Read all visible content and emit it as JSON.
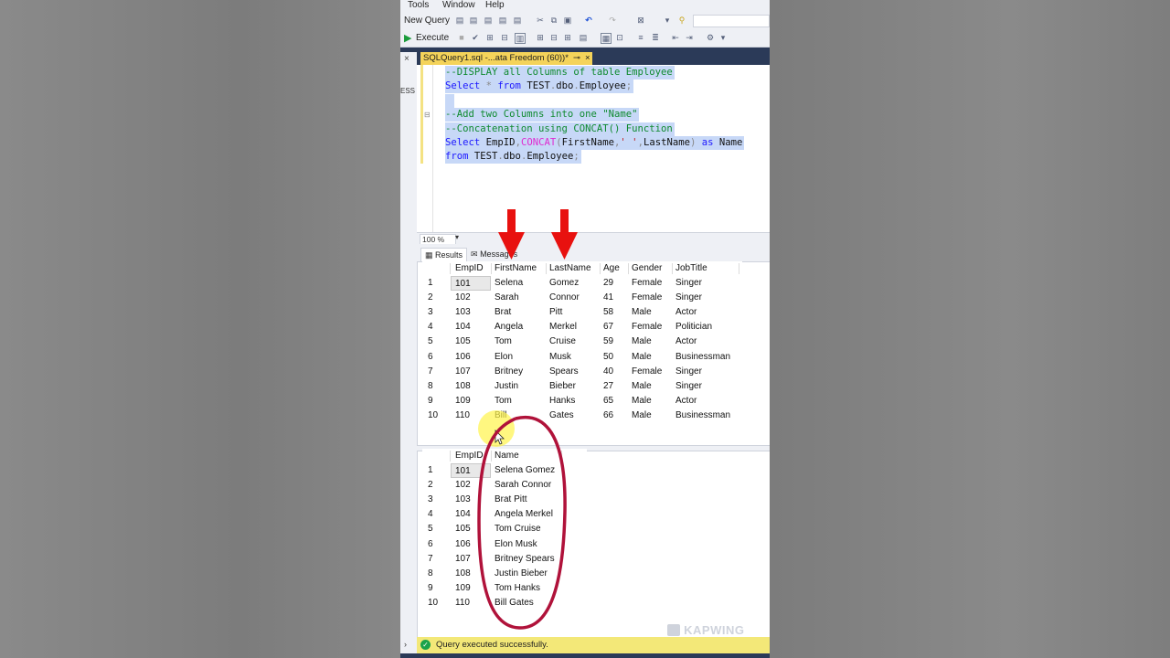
{
  "menu": [
    "Tools",
    "Window",
    "Help"
  ],
  "toolbar": {
    "new_query_label": "New Query",
    "execute_label": "Execute"
  },
  "left_strip_text": "ESS",
  "tab": {
    "title": "SQLQuery1.sql -...ata Freedom (60))*",
    "pin": "⊸",
    "close": "×"
  },
  "code_lines": [
    {
      "segments": [
        {
          "t": "--DISPLAY all Columns of table Employee",
          "c": "cm"
        }
      ]
    },
    {
      "segments": [
        {
          "t": "Select",
          "c": "kw"
        },
        {
          "t": " * ",
          "c": "gr"
        },
        {
          "t": "from",
          "c": "kw"
        },
        {
          "t": " TEST",
          "c": "id"
        },
        {
          "t": ".",
          "c": "gr"
        },
        {
          "t": "dbo",
          "c": "id"
        },
        {
          "t": ".",
          "c": "gr"
        },
        {
          "t": "Employee",
          "c": "id"
        },
        {
          "t": ";",
          "c": "gr"
        }
      ]
    },
    {
      "segments": [
        {
          "t": "",
          "c": "id"
        }
      ]
    },
    {
      "segments": [
        {
          "t": "--Add two Columns into one \"Name\"",
          "c": "cm"
        }
      ]
    },
    {
      "segments": [
        {
          "t": "--Concatenation using CONCAT() Function",
          "c": "cm"
        }
      ]
    },
    {
      "segments": [
        {
          "t": "Select",
          "c": "kw"
        },
        {
          "t": " EmpID",
          "c": "id"
        },
        {
          "t": ",",
          "c": "gr"
        },
        {
          "t": "CONCAT",
          "c": "fn"
        },
        {
          "t": "(",
          "c": "gr"
        },
        {
          "t": "FirstName",
          "c": "id"
        },
        {
          "t": ",",
          "c": "gr"
        },
        {
          "t": "' '",
          "c": "str"
        },
        {
          "t": ",",
          "c": "gr"
        },
        {
          "t": "LastName",
          "c": "id"
        },
        {
          "t": ")",
          "c": "gr"
        },
        {
          "t": " as ",
          "c": "kw"
        },
        {
          "t": "Name",
          "c": "id"
        }
      ]
    },
    {
      "segments": [
        {
          "t": "from",
          "c": "kw"
        },
        {
          "t": " TEST",
          "c": "id"
        },
        {
          "t": ".",
          "c": "gr"
        },
        {
          "t": "dbo",
          "c": "id"
        },
        {
          "t": ".",
          "c": "gr"
        },
        {
          "t": "Employee",
          "c": "id"
        },
        {
          "t": ";",
          "c": "gr"
        }
      ]
    }
  ],
  "zoom": "100 %",
  "result_tabs": {
    "results": "Results",
    "messages": "Messages"
  },
  "table1": {
    "headers": [
      "EmpID",
      "FirstName",
      "LastName",
      "Age",
      "Gender",
      "JobTitle"
    ],
    "rows": [
      [
        "1",
        "101",
        "Selena",
        "Gomez",
        "29",
        "Female",
        "Singer"
      ],
      [
        "2",
        "102",
        "Sarah",
        "Connor",
        "41",
        "Female",
        "Singer"
      ],
      [
        "3",
        "103",
        "Brat",
        "Pitt",
        "58",
        "Male",
        "Actor"
      ],
      [
        "4",
        "104",
        "Angela",
        "Merkel",
        "67",
        "Female",
        "Politician"
      ],
      [
        "5",
        "105",
        "Tom",
        "Cruise",
        "59",
        "Male",
        "Actor"
      ],
      [
        "6",
        "106",
        "Elon",
        "Musk",
        "50",
        "Male",
        "Businessman"
      ],
      [
        "7",
        "107",
        "Britney",
        "Spears",
        "40",
        "Female",
        "Singer"
      ],
      [
        "8",
        "108",
        "Justin",
        "Bieber",
        "27",
        "Male",
        "Singer"
      ],
      [
        "9",
        "109",
        "Tom",
        "Hanks",
        "65",
        "Male",
        "Actor"
      ],
      [
        "10",
        "110",
        "Bill",
        "Gates",
        "66",
        "Male",
        "Businessman"
      ]
    ]
  },
  "table2": {
    "headers": [
      "EmpID",
      "Name"
    ],
    "rows": [
      [
        "1",
        "101",
        "Selena Gomez"
      ],
      [
        "2",
        "102",
        "Sarah Connor"
      ],
      [
        "3",
        "103",
        "Brat Pitt"
      ],
      [
        "4",
        "104",
        "Angela Merkel"
      ],
      [
        "5",
        "105",
        "Tom Cruise"
      ],
      [
        "6",
        "106",
        "Elon Musk"
      ],
      [
        "7",
        "107",
        "Britney Spears"
      ],
      [
        "8",
        "108",
        "Justin Bieber"
      ],
      [
        "9",
        "109",
        "Tom Hanks"
      ],
      [
        "10",
        "110",
        "Bill Gates"
      ]
    ]
  },
  "status": {
    "message": "Query executed successfully."
  },
  "watermark": "KAPWING",
  "colors": {
    "accent_arrow": "#e8110f",
    "ellipse": "#b0123a",
    "highlight": "#fff34a",
    "selection": "#c7d8f7",
    "tab_active": "#f4d35a",
    "status_bg": "#f3e878"
  }
}
